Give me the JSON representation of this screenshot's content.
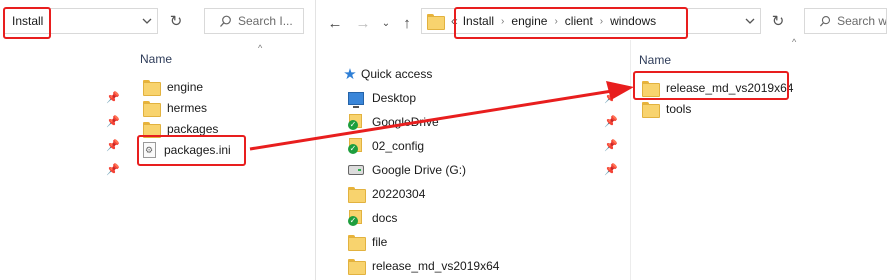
{
  "left_window": {
    "address": "Install",
    "search_placeholder": "Search I...",
    "column_header": "Name",
    "items": [
      {
        "name": "engine",
        "type": "folder"
      },
      {
        "name": "hermes",
        "type": "folder"
      },
      {
        "name": "packages",
        "type": "folder"
      },
      {
        "name": "packages.ini",
        "type": "ini"
      }
    ]
  },
  "right_window": {
    "breadcrumb_overflow": "«",
    "breadcrumb": [
      "Install",
      "engine",
      "client",
      "windows"
    ],
    "search_placeholder": "Search wi",
    "column_header": "Name",
    "nav_pane": [
      {
        "label": "Quick access",
        "icon": "star-icon"
      },
      {
        "label": "Desktop",
        "icon": "desktop-icon"
      },
      {
        "label": "GoogleDrive",
        "icon": "google-drive-folder-icon"
      },
      {
        "label": "02_config",
        "icon": "google-drive-folder-icon"
      },
      {
        "label": "Google Drive (G:)",
        "icon": "drive-icon"
      },
      {
        "label": "20220304",
        "icon": "folder-icon"
      },
      {
        "label": "docs",
        "icon": "google-drive-folder-icon"
      },
      {
        "label": "file",
        "icon": "folder-icon"
      },
      {
        "label": "release_md_vs2019x64",
        "icon": "folder-icon"
      }
    ],
    "items": [
      {
        "name": "release_md_vs2019x64",
        "type": "folder"
      },
      {
        "name": "tools",
        "type": "folder"
      }
    ]
  },
  "colors": {
    "highlight": "#e81e1e",
    "folder": "#f8d36e",
    "header_text": "#2f3d5a"
  }
}
